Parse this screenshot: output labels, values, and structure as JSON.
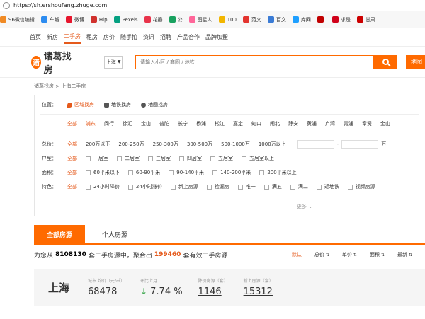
{
  "browser": {
    "url": "https://sh.ershoufang.zhuge.com",
    "bookmarks": [
      {
        "label": "96微信编辑",
        "color": "#f08a24"
      },
      {
        "label": "车城",
        "color": "#2d8cf0"
      },
      {
        "label": "微博",
        "color": "#e6162d"
      },
      {
        "label": "Hip",
        "color": "#d0312d"
      },
      {
        "label": "Pexels",
        "color": "#05a081"
      },
      {
        "label": "花瓣",
        "color": "#e8334a"
      },
      {
        "label": "公",
        "color": "#19a15f"
      },
      {
        "label": "图星人",
        "color": "#ff6699"
      },
      {
        "label": "100",
        "color": "#f2b600"
      },
      {
        "label": "范文",
        "color": "#e3342f"
      },
      {
        "label": "百文",
        "color": "#3a7bd5"
      },
      {
        "label": "库网",
        "color": "#1e9fff"
      },
      {
        "label": "",
        "color": "#c00000"
      },
      {
        "label": "求是",
        "color": "#d0021b"
      },
      {
        "label": "甘肃",
        "color": "#cc0000"
      }
    ]
  },
  "topnav": [
    "首页",
    "新房",
    "二手房",
    "租房",
    "房价",
    "随手拍",
    "资讯",
    "招聘",
    "产品合作",
    "品牌加盟"
  ],
  "header": {
    "logo_text": "诸葛找房",
    "city": "上海",
    "search_placeholder": "请输入小区 / 商圈 / 地铁",
    "map_button": "地图"
  },
  "breadcrumb": "诸葛找房 > 上海二手房",
  "filters": {
    "position": {
      "label": "位置：",
      "tabs": [
        "区域找房",
        "地铁找房",
        "地图找房"
      ],
      "districts": [
        "全部",
        "浦东",
        "闵行",
        "徐汇",
        "宝山",
        "普陀",
        "长宁",
        "杨浦",
        "松江",
        "嘉定",
        "虹口",
        "闸北",
        "静安",
        "黄浦",
        "卢湾",
        "青浦",
        "奉贤",
        "金山"
      ]
    },
    "price": {
      "label": "总价：",
      "options": [
        "全部",
        "200万以下",
        "200-250万",
        "250-300万",
        "300-500万",
        "500-1000万",
        "1000万以上"
      ],
      "unit": "万"
    },
    "layout": {
      "label": "户型：",
      "all": "全部",
      "options": [
        "一居室",
        "二居室",
        "三居室",
        "四居室",
        "五居室",
        "五居室以上"
      ]
    },
    "area": {
      "label": "面积：",
      "all": "全部",
      "options": [
        "60平米以下",
        "60-90平米",
        "90-140平米",
        "140-200平米",
        "200平米以上"
      ]
    },
    "features": {
      "label": "特色：",
      "all": "全部",
      "options": [
        "24小时降价",
        "24小时涨价",
        "新上房源",
        "捡漏房",
        "唯一",
        "满五",
        "满二",
        "近地铁",
        "视频房源"
      ]
    },
    "more": "更多"
  },
  "tabs": {
    "main": "全部房源",
    "personal": "个人房源"
  },
  "summary": {
    "prefix": "为您从",
    "total": "8108130",
    "mid": "套二手房源中，聚合出",
    "valid": "199460",
    "suffix": "套有效二手房源"
  },
  "sorts": [
    "默认",
    "总价",
    "单价",
    "面积",
    "最新"
  ],
  "stats": {
    "city": "上海",
    "avg_price_label": "城市 均价（元/㎡）",
    "avg_price": "68478",
    "mom_label": "环比上月",
    "mom_value": "7.74 %",
    "price_drop_label": "降价房源（套）",
    "price_drop": "1146",
    "new_label": "新上房源（套）",
    "new_count": "15312"
  },
  "colors": {
    "accent": "#ff6a00",
    "accent_text": "#e55a1c",
    "down": "#3aa64b"
  }
}
